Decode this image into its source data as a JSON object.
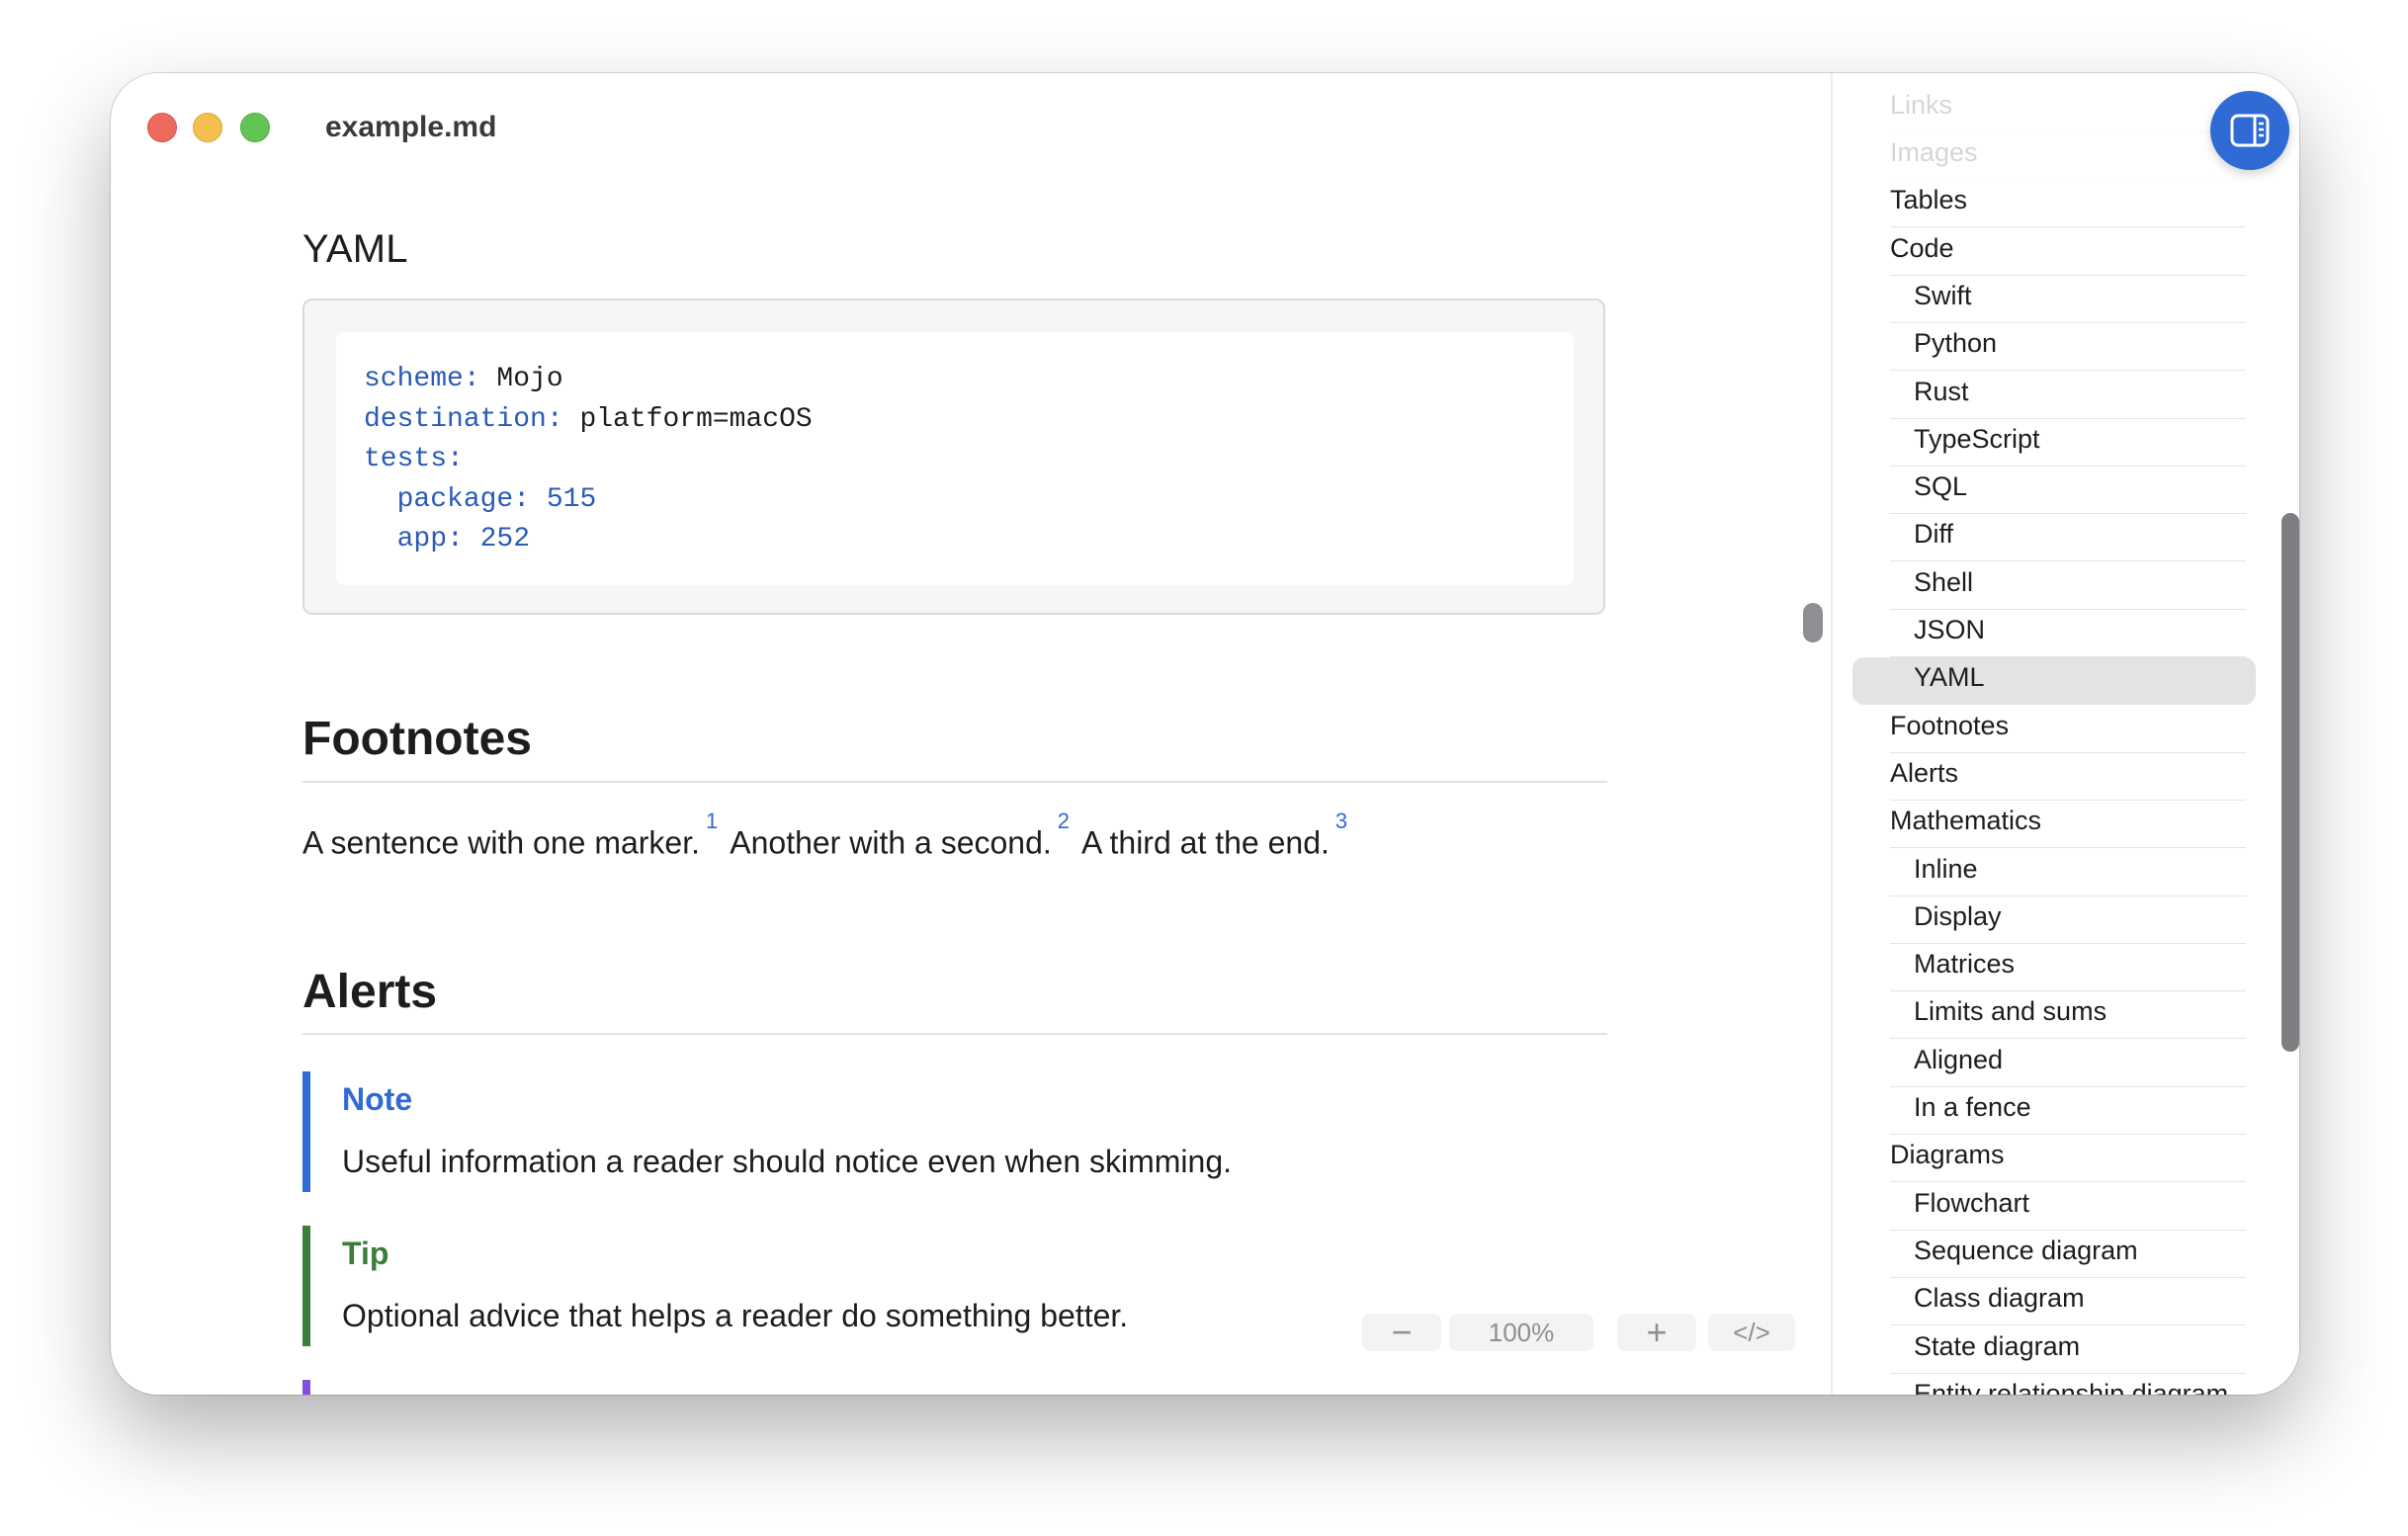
{
  "window": {
    "title": "example.md"
  },
  "document": {
    "yaml_heading": "YAML",
    "code": {
      "lines": [
        {
          "indent": "",
          "key": "scheme:",
          "value": " Mojo",
          "value_kind": "text"
        },
        {
          "indent": "",
          "key": "destination:",
          "value": " platform=macOS",
          "value_kind": "text"
        },
        {
          "indent": "",
          "key": "tests:",
          "value": "",
          "value_kind": "text"
        },
        {
          "indent": "  ",
          "key": "package:",
          "value": " 515",
          "value_kind": "number"
        },
        {
          "indent": "  ",
          "key": "app:",
          "value": " 252",
          "value_kind": "number"
        }
      ]
    },
    "footnotes_heading": "Footnotes",
    "footnotes_paragraph": {
      "s1": "A sentence with one marker.",
      "m1": "1",
      "s2": "Another with a second.",
      "m2": "2",
      "s3": "A third at the end.",
      "m3": "3"
    },
    "alerts_heading": "Alerts",
    "alerts": [
      {
        "title": "Note",
        "body": "Useful information a reader should notice even when skimming.",
        "color": "#2f6ad5",
        "title_color": "#2f6ad5"
      },
      {
        "title": "Tip",
        "body": "Optional advice that helps a reader do something better.",
        "color": "#3b7d3a",
        "title_color": "#3b7d3a"
      }
    ],
    "next_alert_color": "#8250df"
  },
  "zoom": {
    "minus": "−",
    "level": "100%",
    "plus": "+",
    "code": "</>"
  },
  "sidebar": {
    "toggle_icon": "sidebar-toggle-icon",
    "items": [
      {
        "label": "Links",
        "level": 1,
        "faded": true
      },
      {
        "label": "Images",
        "level": 1,
        "faded": true
      },
      {
        "label": "Tables",
        "level": 1
      },
      {
        "label": "Code",
        "level": 1
      },
      {
        "label": "Swift",
        "level": 2
      },
      {
        "label": "Python",
        "level": 2
      },
      {
        "label": "Rust",
        "level": 2
      },
      {
        "label": "TypeScript",
        "level": 2
      },
      {
        "label": "SQL",
        "level": 2
      },
      {
        "label": "Diff",
        "level": 2
      },
      {
        "label": "Shell",
        "level": 2
      },
      {
        "label": "JSON",
        "level": 2
      },
      {
        "label": "YAML",
        "level": 2,
        "active": true
      },
      {
        "label": "Footnotes",
        "level": 1
      },
      {
        "label": "Alerts",
        "level": 1
      },
      {
        "label": "Mathematics",
        "level": 1
      },
      {
        "label": "Inline",
        "level": 2
      },
      {
        "label": "Display",
        "level": 2
      },
      {
        "label": "Matrices",
        "level": 2
      },
      {
        "label": "Limits and sums",
        "level": 2
      },
      {
        "label": "Aligned",
        "level": 2
      },
      {
        "label": "In a fence",
        "level": 2
      },
      {
        "label": "Diagrams",
        "level": 1
      },
      {
        "label": "Flowchart",
        "level": 2
      },
      {
        "label": "Sequence diagram",
        "level": 2
      },
      {
        "label": "Class diagram",
        "level": 2
      },
      {
        "label": "State diagram",
        "level": 2
      },
      {
        "label": "Entity relationship diagram",
        "level": 2
      }
    ]
  }
}
